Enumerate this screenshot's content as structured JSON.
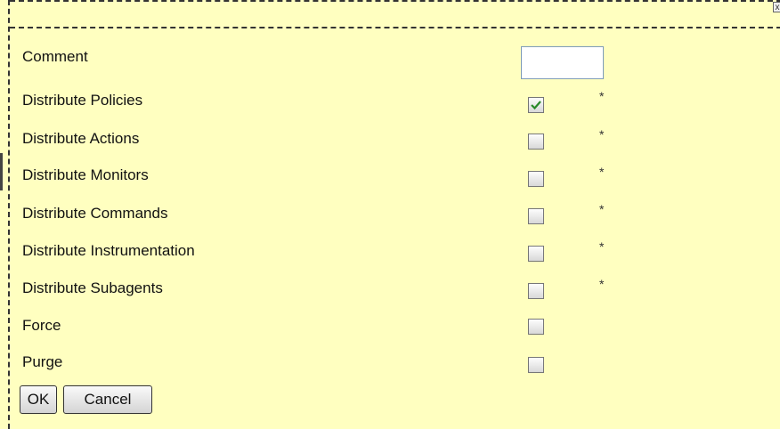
{
  "dialog": {
    "close_glyph": "x"
  },
  "comment": {
    "label": "Comment",
    "value": ""
  },
  "options": [
    {
      "label": "Distribute Policies",
      "checked": true,
      "required_marker": "*"
    },
    {
      "label": "Distribute Actions",
      "checked": false,
      "required_marker": "*"
    },
    {
      "label": "Distribute Monitors",
      "checked": false,
      "required_marker": "*"
    },
    {
      "label": "Distribute Commands",
      "checked": false,
      "required_marker": "*"
    },
    {
      "label": "Distribute Instrumentation",
      "checked": false,
      "required_marker": "*"
    },
    {
      "label": "Distribute Subagents",
      "checked": false,
      "required_marker": "*"
    },
    {
      "label": "Force",
      "checked": false,
      "required_marker": ""
    },
    {
      "label": "Purge",
      "checked": false,
      "required_marker": ""
    }
  ],
  "buttons": {
    "ok_label": "OK",
    "cancel_label": "Cancel"
  },
  "colors": {
    "background": "#ffffc0",
    "check_mark": "#2a8a2a"
  }
}
